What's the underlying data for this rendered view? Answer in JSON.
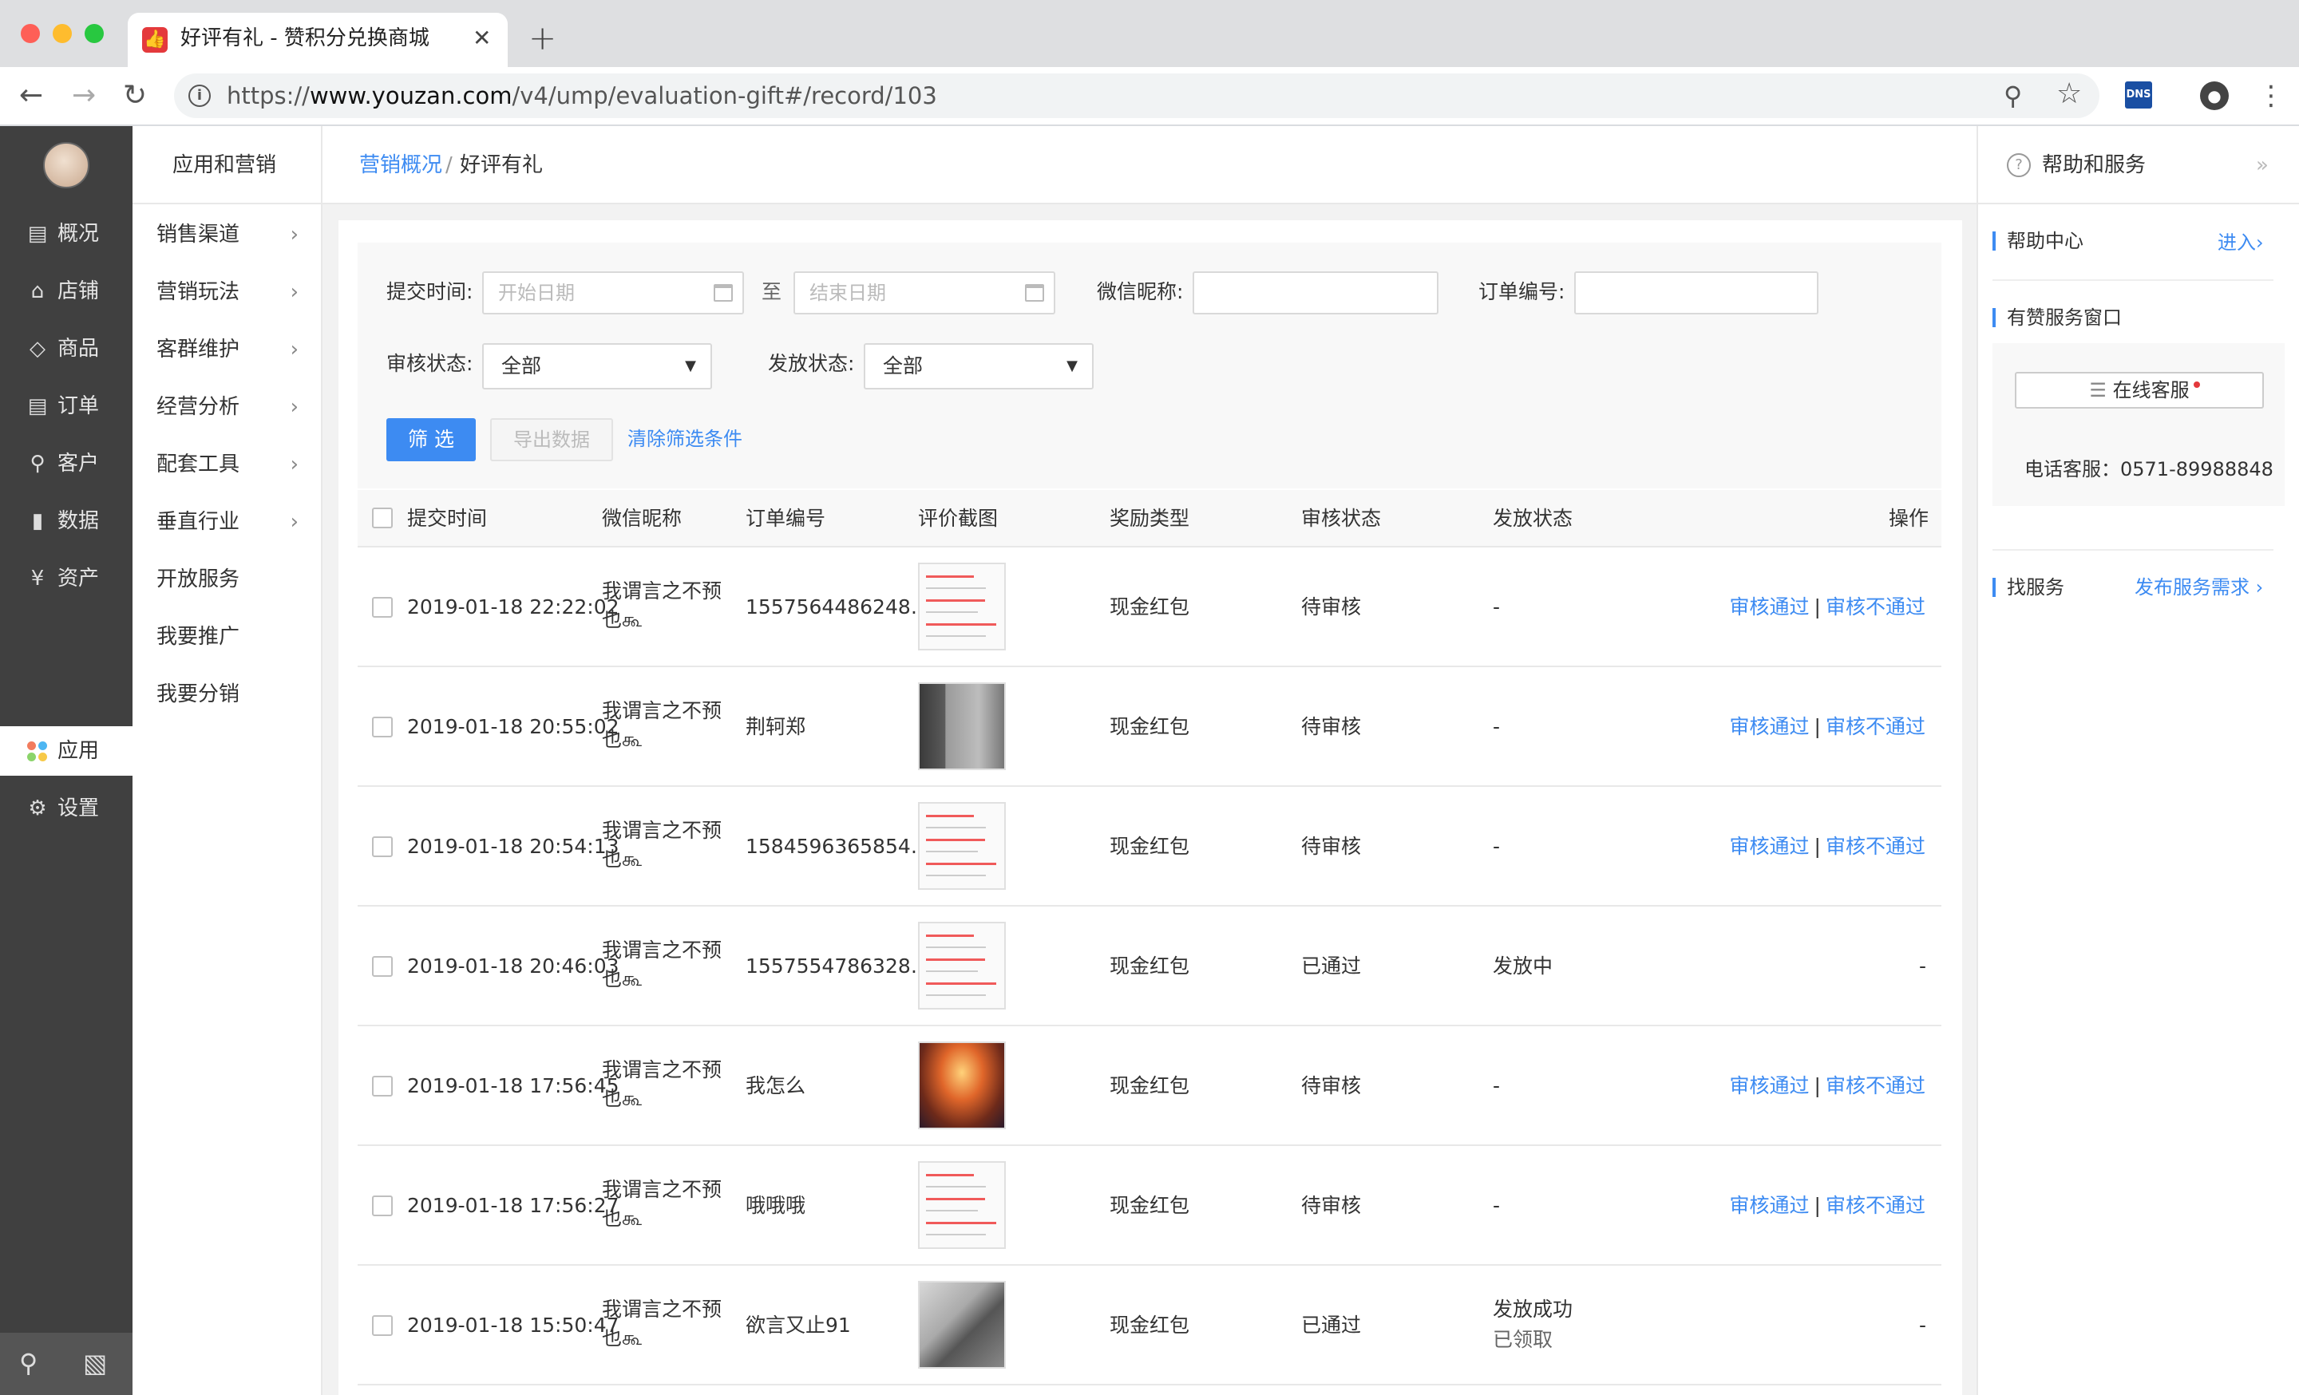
{
  "browser": {
    "tab_title": "好评有礼 - 赞积分兑换商城",
    "url_scheme": "https://",
    "url_host": "www.youzan.com",
    "url_path": "/v4/ump/evaluation-gift#/record/103",
    "dns_badge": "DNS"
  },
  "sidebar": {
    "items": [
      {
        "label": "概况",
        "icon": "dashboard-icon"
      },
      {
        "label": "店铺",
        "icon": "store-icon"
      },
      {
        "label": "商品",
        "icon": "tag-icon"
      },
      {
        "label": "订单",
        "icon": "order-icon"
      },
      {
        "label": "客户",
        "icon": "user-icon"
      },
      {
        "label": "数据",
        "icon": "bar-chart-icon"
      },
      {
        "label": "资产",
        "icon": "yen-icon"
      },
      {
        "label": "应用",
        "icon": "apps-icon"
      },
      {
        "label": "设置",
        "icon": "gear-icon"
      }
    ],
    "active": "应用"
  },
  "subnav": {
    "title": "应用和营销",
    "items": [
      {
        "label": "销售渠道",
        "chevron": true
      },
      {
        "label": "营销玩法",
        "chevron": true
      },
      {
        "label": "客群维护",
        "chevron": true
      },
      {
        "label": "经营分析",
        "chevron": true
      },
      {
        "label": "配套工具",
        "chevron": true
      },
      {
        "label": "垂直行业",
        "chevron": true
      },
      {
        "label": "开放服务",
        "chevron": false
      },
      {
        "label": "我要推广",
        "chevron": false
      },
      {
        "label": "我要分销",
        "chevron": false
      }
    ]
  },
  "breadcrumb": {
    "parent": "营销概况",
    "separator": "/",
    "current": "好评有礼"
  },
  "filter": {
    "submit_time_label": "提交时间:",
    "start_placeholder": "开始日期",
    "to_label": "至",
    "end_placeholder": "结束日期",
    "wechat_label": "微信昵称:",
    "order_label": "订单编号:",
    "review_status_label": "审核状态:",
    "review_status_value": "全部",
    "issue_status_label": "发放状态:",
    "issue_status_value": "全部",
    "filter_button": "筛 选",
    "export_button": "导出数据",
    "clear_link": "清除筛选条件"
  },
  "table": {
    "headers": [
      "提交时间",
      "微信昵称",
      "订单编号",
      "评价截图",
      "奖励类型",
      "审核状态",
      "发放状态",
      "操作"
    ],
    "approve_label": "审核通过",
    "reject_label": "审核不通过",
    "op_separator": "|",
    "rows": [
      {
        "time": "2019-01-18 22:22:02",
        "nick": "我谓言之不预也கூ",
        "order": "1557564486248…",
        "thumb": "doc",
        "reward": "现金红包",
        "review": "待审核",
        "issue": "-",
        "issue_sub": "",
        "ops": true
      },
      {
        "time": "2019-01-18 20:55:02",
        "nick": "我谓言之不预也கூ",
        "order": "荆轲郑",
        "thumb": "photo1",
        "reward": "现金红包",
        "review": "待审核",
        "issue": "-",
        "issue_sub": "",
        "ops": true
      },
      {
        "time": "2019-01-18 20:54:13",
        "nick": "我谓言之不预也கூ",
        "order": "1584596365854…",
        "thumb": "doc",
        "reward": "现金红包",
        "review": "待审核",
        "issue": "-",
        "issue_sub": "",
        "ops": true
      },
      {
        "time": "2019-01-18 20:46:03",
        "nick": "我谓言之不预也கூ",
        "order": "1557554786328…",
        "thumb": "doc",
        "reward": "现金红包",
        "review": "已通过",
        "issue": "发放中",
        "issue_sub": "",
        "ops": false
      },
      {
        "time": "2019-01-18 17:56:45",
        "nick": "我谓言之不预也கூ",
        "order": "我怎么",
        "thumb": "photo2",
        "reward": "现金红包",
        "review": "待审核",
        "issue": "-",
        "issue_sub": "",
        "ops": true
      },
      {
        "time": "2019-01-18 17:56:27",
        "nick": "我谓言之不预也கூ",
        "order": "哦哦哦",
        "thumb": "doc",
        "reward": "现金红包",
        "review": "待审核",
        "issue": "-",
        "issue_sub": "",
        "ops": true
      },
      {
        "time": "2019-01-18 15:50:47",
        "nick": "我谓言之不预也கூ",
        "order": "欲言又止91",
        "thumb": "photo3",
        "reward": "现金红包",
        "review": "已通过",
        "issue": "发放成功",
        "issue_sub": "已领取",
        "ops": false
      }
    ],
    "no_op": "-"
  },
  "help": {
    "title": "帮助和服务",
    "help_center": "帮助中心",
    "enter_link": "进入",
    "service_window": "有赞服务窗口",
    "online_service": "在线客服",
    "phone": "电话客服：0571-89988848",
    "find_service": "找服务",
    "publish_link": "发布服务需求"
  },
  "colors": {
    "accent": "#3d8bf2",
    "sidebar_bg": "#404040",
    "badge_red": "#e4393c"
  }
}
